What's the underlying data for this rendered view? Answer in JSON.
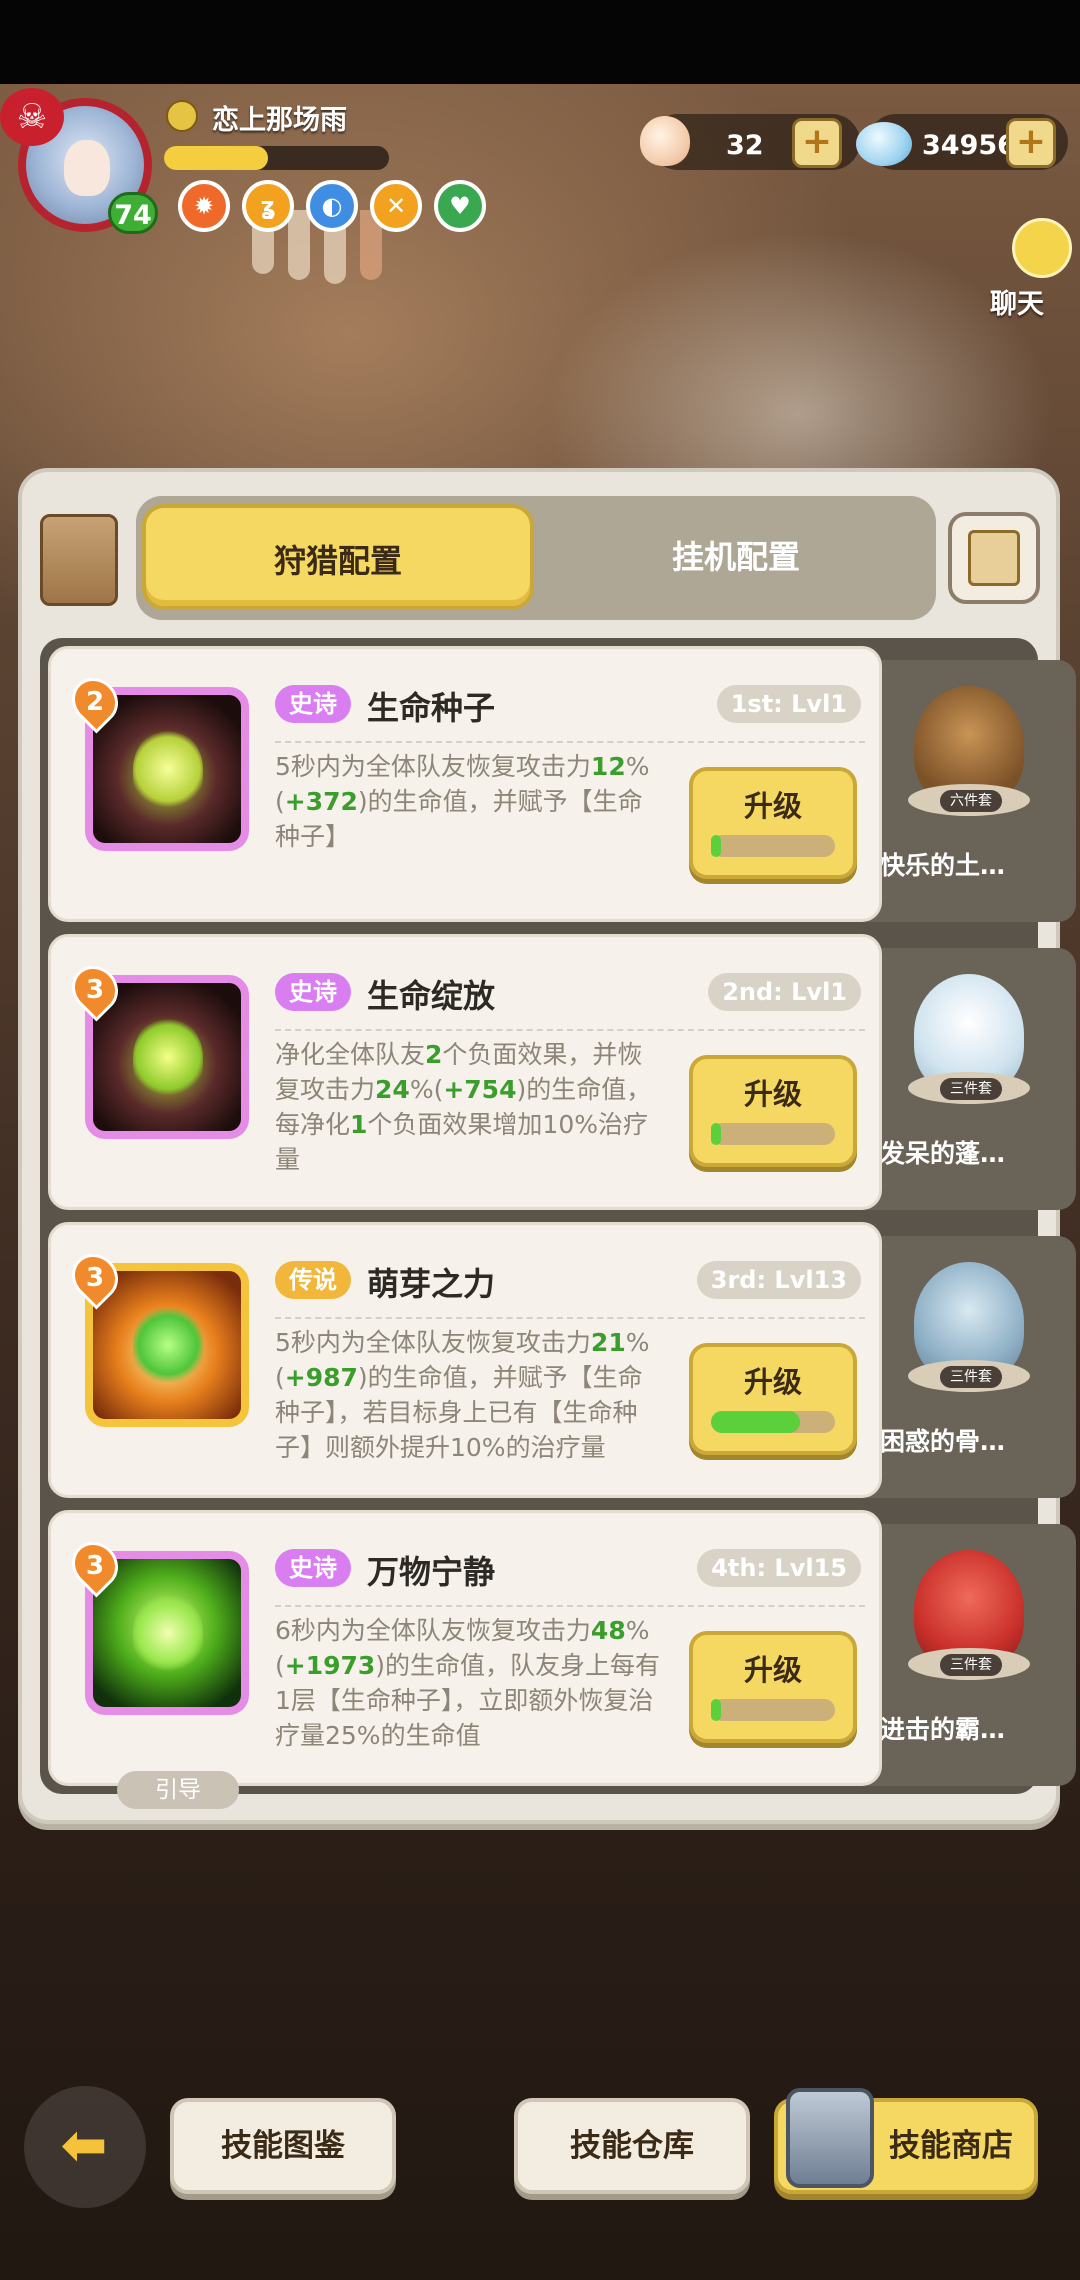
{
  "player": {
    "name": "恋上那场雨",
    "level": "74",
    "xp_progress": 0.46
  },
  "currency": {
    "shells": "32",
    "gems": "34956"
  },
  "chat": {
    "label": "聊天"
  },
  "tabs": {
    "hunt": "狩猎配置",
    "idle": "挂机配置"
  },
  "skills": [
    {
      "level": "2",
      "rarity": "史诗",
      "name": "生命种子",
      "slot": "1st: Lvl1",
      "desc": "5秒内为全体队友恢复攻击力12%(+372)的生命值，并赋予【生命种子】",
      "upgrade_label": "升级",
      "progress": 0.05,
      "set_name": "快乐的土…",
      "set_tag": "六件套"
    },
    {
      "level": "3",
      "rarity": "史诗",
      "name": "生命绽放",
      "slot": "2nd: Lvl1",
      "desc": "净化全体队友2个负面效果，并恢复攻击力24%(+754)的生命值，每净化1个负面效果增加10%治疗量",
      "upgrade_label": "升级",
      "progress": 0.05,
      "set_name": "发呆的蓬…",
      "set_tag": "三件套"
    },
    {
      "level": "3",
      "rarity": "传说",
      "name": "萌芽之力",
      "slot": "3rd: Lvl13",
      "desc": "5秒内为全体队友恢复攻击力21%(+987)的生命值，并赋予【生命种子】，若目标身上已有【生命种子】则额外提升10%的治疗量",
      "upgrade_label": "升级",
      "progress": 0.72,
      "set_name": "困惑的骨…",
      "set_tag": "三件套"
    },
    {
      "level": "3",
      "rarity": "史诗",
      "name": "万物宁静",
      "slot": "4th: Lvl15",
      "desc": "6秒内为全体队友恢复攻击力48%(+1973)的生命值，队友身上每有1层【生命种子】，立即额外恢复治疗量25%的生命值",
      "upgrade_label": "升级",
      "progress": 0.05,
      "set_name": "进击的霸…",
      "set_tag": "三件套",
      "channel": "引导"
    }
  ],
  "bottom": {
    "codex": "技能图鉴",
    "storage": "技能仓库",
    "shop": "技能商店"
  },
  "colors": {
    "accent_yellow": "#f5d862",
    "epic": "#d87ef0",
    "legend": "#f2b73a",
    "value_green": "#3a9d2c"
  }
}
